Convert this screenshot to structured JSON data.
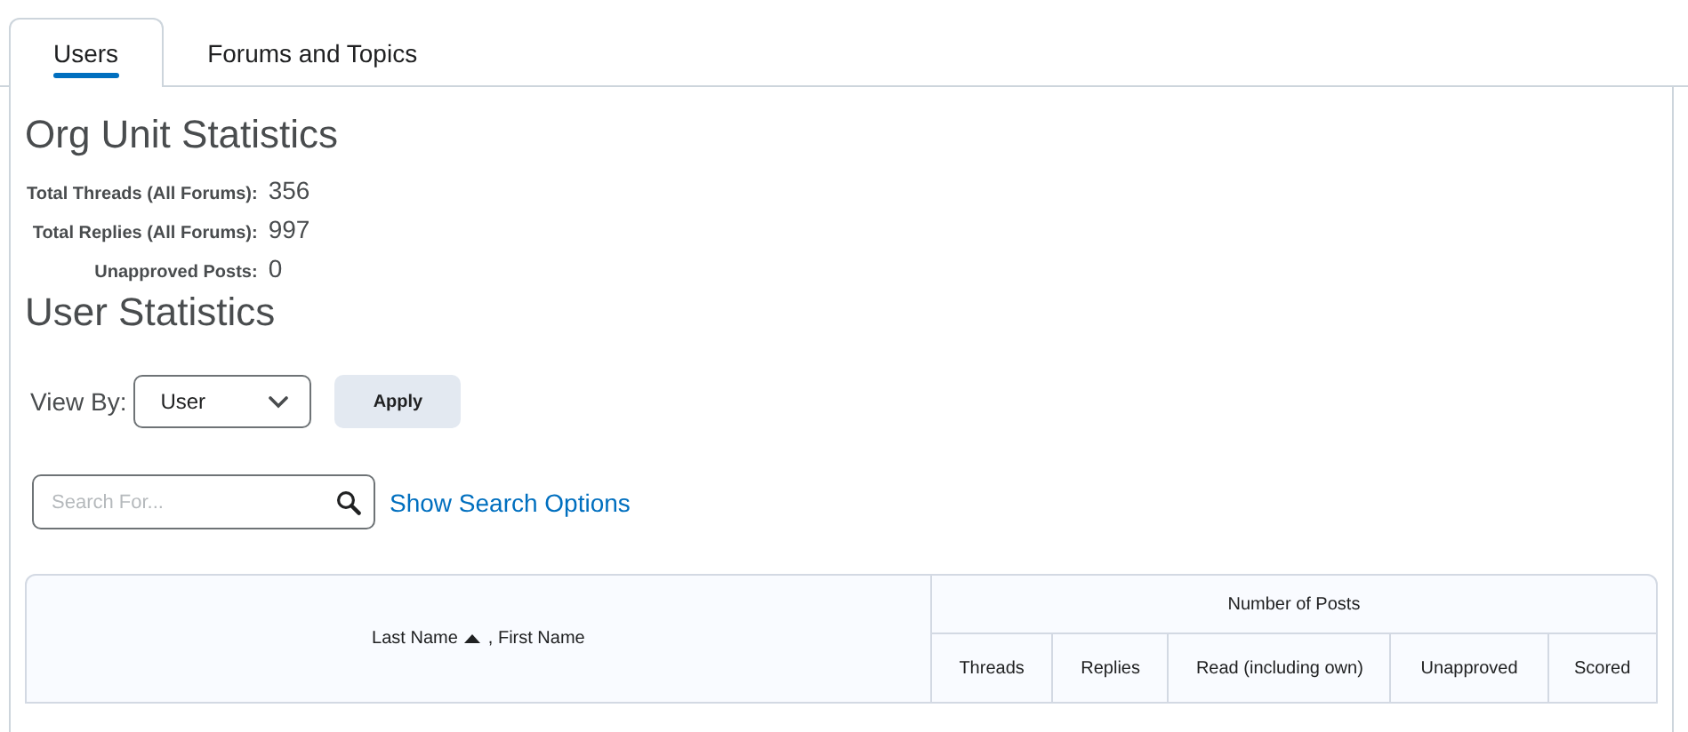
{
  "tabs": [
    {
      "label": "Users",
      "selected": true
    },
    {
      "label": "Forums and Topics",
      "selected": false
    }
  ],
  "org_unit_statistics": {
    "title": "Org Unit Statistics",
    "stats": [
      {
        "label": "Total Threads (All Forums):",
        "value": "356"
      },
      {
        "label": "Total Replies (All Forums):",
        "value": "997"
      },
      {
        "label": "Unapproved Posts:",
        "value": "0"
      }
    ]
  },
  "user_statistics": {
    "title": "User Statistics",
    "view_by": {
      "label": "View By:",
      "value": "User"
    },
    "apply_button": "Apply",
    "search": {
      "placeholder": "Search For..."
    },
    "search_options_link": "Show Search Options"
  },
  "table": {
    "name_column": {
      "sort_label": "Last Name",
      "sort_ascending": true,
      "rest_label": ", First Name"
    },
    "group_heading": "Number of Posts",
    "columns": [
      "Threads",
      "Replies",
      "Read (including own)",
      "Unapproved",
      "Scored"
    ]
  }
}
